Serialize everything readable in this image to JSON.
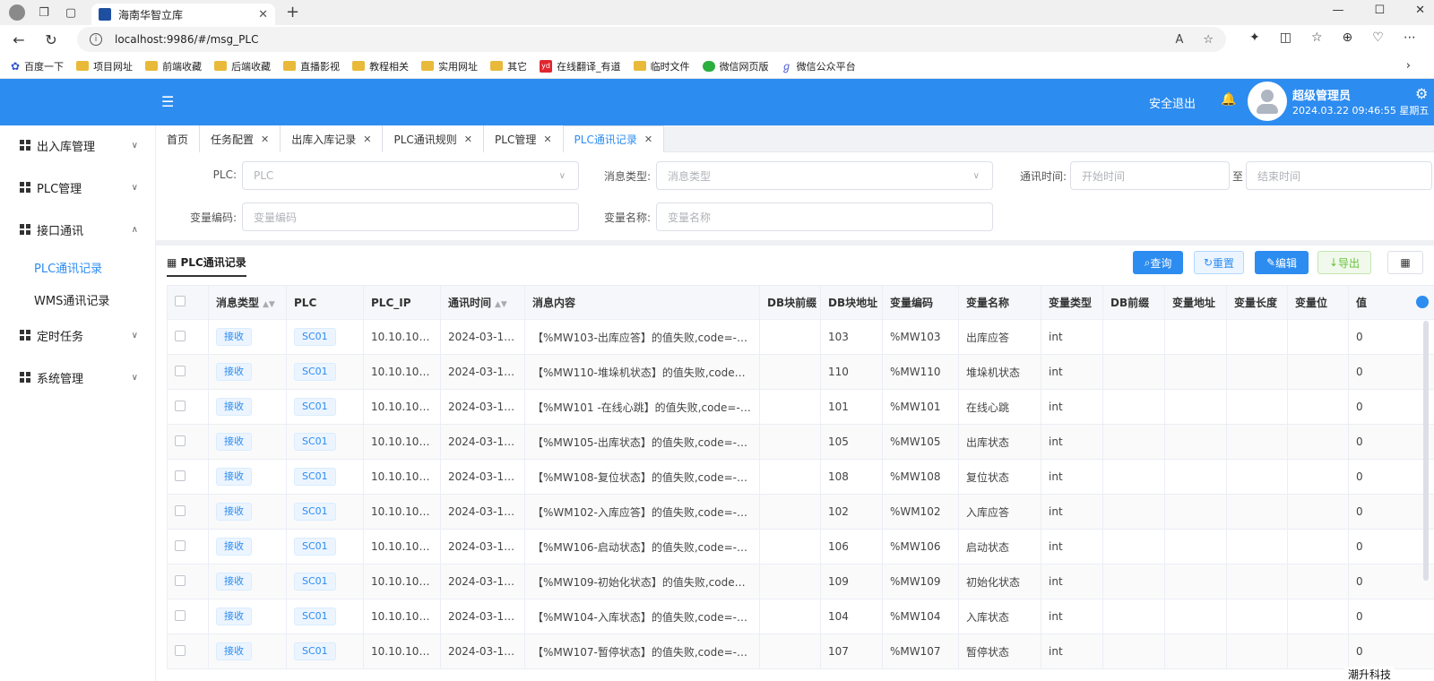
{
  "browser": {
    "tab_title": "海南华智立库",
    "url": "localhost:9986/#/msg_PLC",
    "bookmarks": [
      "百度一下",
      "项目网址",
      "前端收藏",
      "后端收藏",
      "直播影视",
      "教程相关",
      "实用网址",
      "其它",
      "在线翻译_有道",
      "临时文件",
      "微信网页版",
      "微信公众平台"
    ]
  },
  "header": {
    "logout": "安全退出",
    "username": "超级管理员",
    "datetime": "2024.03.22 09:46:55 星期五"
  },
  "sidebar": {
    "items": [
      {
        "label": "出入库管理"
      },
      {
        "label": "PLC管理"
      },
      {
        "label": "接口通讯"
      },
      {
        "label": "定时任务"
      },
      {
        "label": "系统管理"
      }
    ],
    "sub_items": [
      {
        "label": "PLC通讯记录"
      },
      {
        "label": "WMS通讯记录"
      }
    ]
  },
  "tabs": [
    "首页",
    "任务配置",
    "出库入库记录",
    "PLC通讯规则",
    "PLC管理",
    "PLC通讯记录"
  ],
  "filters": {
    "plc_label": "PLC:",
    "plc_placeholder": "PLC",
    "msgtype_label": "消息类型:",
    "msgtype_placeholder": "消息类型",
    "time_label": "通讯时间:",
    "start_placeholder": "开始时间",
    "to": "至",
    "end_placeholder": "结束时间",
    "varcode_label": "变量编码:",
    "varcode_placeholder": "变量编码",
    "varname_label": "变量名称:",
    "varname_placeholder": "变量名称"
  },
  "toolbar": {
    "title": "PLC通讯记录",
    "query": "查询",
    "reset": "重置",
    "edit": "编辑",
    "export": "导出"
  },
  "table": {
    "columns": [
      "消息类型",
      "PLC",
      "PLC_IP",
      "通讯时间",
      "消息内容",
      "DB块前缀",
      "DB块地址",
      "变量编码",
      "变量名称",
      "变量类型",
      "DB前缀",
      "变量地址",
      "变量长度",
      "变量位",
      "值"
    ],
    "rows": [
      {
        "type": "接收",
        "plc": "SC01",
        "ip": "10.10.100…",
        "time": "2024-03-13…",
        "msg": "【%MW103-出库应答】的值失败,code=-1,…",
        "db_prefix": "",
        "db_addr": "103",
        "code": "%MW103",
        "name": "出库应答",
        "vtype": "int",
        "dbp": "",
        "vaddr": "",
        "vlen": "",
        "vbit": "",
        "val": "0"
      },
      {
        "type": "接收",
        "plc": "SC01",
        "ip": "10.10.100…",
        "time": "2024-03-13…",
        "msg": "【%MW110-堆垛机状态】的值失败,code=-1…",
        "db_prefix": "",
        "db_addr": "110",
        "code": "%MW110",
        "name": "堆垛机状态",
        "vtype": "int",
        "dbp": "",
        "vaddr": "",
        "vlen": "",
        "vbit": "",
        "val": "0"
      },
      {
        "type": "接收",
        "plc": "SC01",
        "ip": "10.10.100…",
        "time": "2024-03-13…",
        "msg": "【%MW101 -在线心跳】的值失败,code=-1,…",
        "db_prefix": "",
        "db_addr": "101",
        "code": "%MW101",
        "name": "在线心跳",
        "vtype": "int",
        "dbp": "",
        "vaddr": "",
        "vlen": "",
        "vbit": "",
        "val": "0"
      },
      {
        "type": "接收",
        "plc": "SC01",
        "ip": "10.10.100…",
        "time": "2024-03-13…",
        "msg": "【%MW105-出库状态】的值失败,code=-1,…",
        "db_prefix": "",
        "db_addr": "105",
        "code": "%MW105",
        "name": "出库状态",
        "vtype": "int",
        "dbp": "",
        "vaddr": "",
        "vlen": "",
        "vbit": "",
        "val": "0"
      },
      {
        "type": "接收",
        "plc": "SC01",
        "ip": "10.10.100…",
        "time": "2024-03-13…",
        "msg": "【%MW108-复位状态】的值失败,code=-1,…",
        "db_prefix": "",
        "db_addr": "108",
        "code": "%MW108",
        "name": "复位状态",
        "vtype": "int",
        "dbp": "",
        "vaddr": "",
        "vlen": "",
        "vbit": "",
        "val": "0"
      },
      {
        "type": "接收",
        "plc": "SC01",
        "ip": "10.10.100…",
        "time": "2024-03-13…",
        "msg": "【%WM102-入库应答】的值失败,code=-1,…",
        "db_prefix": "",
        "db_addr": "102",
        "code": "%WM102",
        "name": "入库应答",
        "vtype": "int",
        "dbp": "",
        "vaddr": "",
        "vlen": "",
        "vbit": "",
        "val": "0"
      },
      {
        "type": "接收",
        "plc": "SC01",
        "ip": "10.10.100…",
        "time": "2024-03-13…",
        "msg": "【%MW106-启动状态】的值失败,code=-1,…",
        "db_prefix": "",
        "db_addr": "106",
        "code": "%MW106",
        "name": "启动状态",
        "vtype": "int",
        "dbp": "",
        "vaddr": "",
        "vlen": "",
        "vbit": "",
        "val": "0"
      },
      {
        "type": "接收",
        "plc": "SC01",
        "ip": "10.10.100…",
        "time": "2024-03-13…",
        "msg": "【%MW109-初始化状态】的值失败,code=-…",
        "db_prefix": "",
        "db_addr": "109",
        "code": "%MW109",
        "name": "初始化状态",
        "vtype": "int",
        "dbp": "",
        "vaddr": "",
        "vlen": "",
        "vbit": "",
        "val": "0"
      },
      {
        "type": "接收",
        "plc": "SC01",
        "ip": "10.10.100…",
        "time": "2024-03-13…",
        "msg": "【%MW104-入库状态】的值失败,code=-1,…",
        "db_prefix": "",
        "db_addr": "104",
        "code": "%MW104",
        "name": "入库状态",
        "vtype": "int",
        "dbp": "",
        "vaddr": "",
        "vlen": "",
        "vbit": "",
        "val": "0"
      },
      {
        "type": "接收",
        "plc": "SC01",
        "ip": "10.10.100…",
        "time": "2024-03-13…",
        "msg": "【%MW107-暂停状态】的值失败,code=-1,…",
        "db_prefix": "",
        "db_addr": "107",
        "code": "%MW107",
        "name": "暂停状态",
        "vtype": "int",
        "dbp": "",
        "vaddr": "",
        "vlen": "",
        "vbit": "",
        "val": "0"
      }
    ]
  },
  "watermark": "潮升科技"
}
